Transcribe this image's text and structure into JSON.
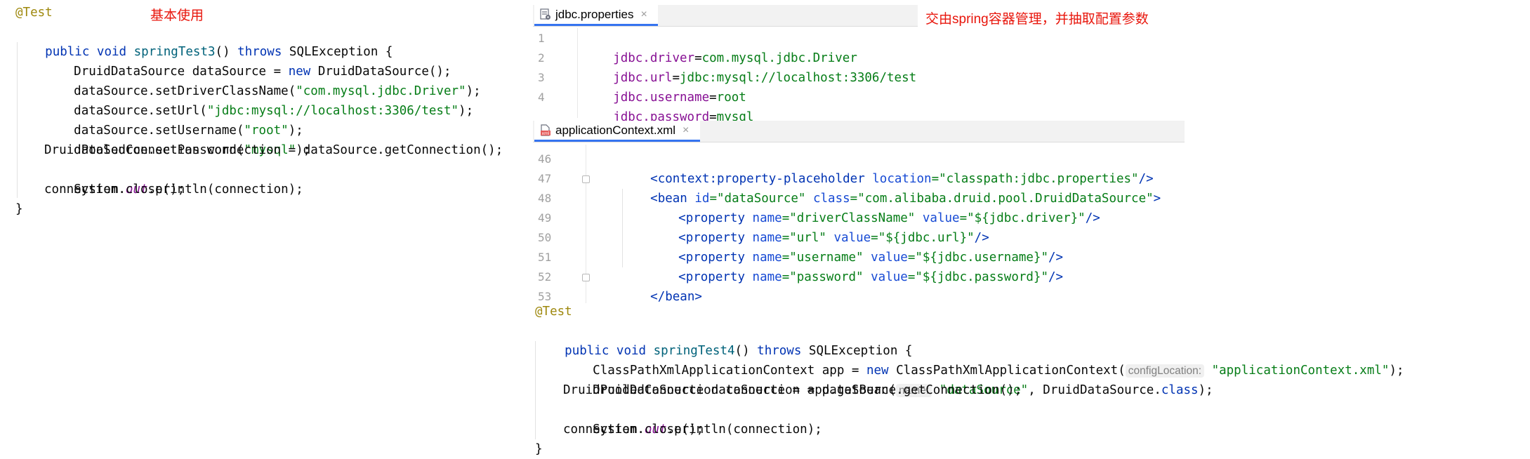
{
  "left_code": {
    "annotation": "@Test",
    "note": "基本使用",
    "signature": {
      "kw1": "public",
      "kw2": "void",
      "method": "springTest3",
      "parens": "()",
      "kw3": "throws",
      "rest": "SQLException {"
    },
    "line1": {
      "a": "DruidDataSource dataSource = ",
      "kw": "new",
      "b": " DruidDataSource();"
    },
    "line2": {
      "a": "dataSource.setDriverClassName(",
      "str": "\"com.mysql.jdbc.Driver\"",
      "b": ");"
    },
    "line3": {
      "a": "dataSource.setUrl(",
      "str": "\"jdbc:mysql://localhost:3306/test\"",
      "b": ");"
    },
    "line4": {
      "a": "dataSource.setUsername(",
      "str": "\"root\"",
      "b": ");"
    },
    "line5": {
      "a": "dataSource.setPassword(",
      "str": "\"mysql\"",
      "b": ");"
    },
    "line6": "DruidPooledConnection connection = dataSource.getConnection();",
    "line7": {
      "a": "System.",
      "static": "out",
      "b": ".println(connection);"
    },
    "line8": "connection.close();",
    "close": "}"
  },
  "props_editor": {
    "tab_label": "jdbc.properties",
    "close_glyph": "×",
    "note": "交由spring容器管理，并抽取配置参数",
    "lines": [
      {
        "num": "1",
        "key": "jdbc.driver",
        "eq": "=",
        "val": "com.mysql.jdbc.Driver"
      },
      {
        "num": "2",
        "key": "jdbc.url",
        "eq": "=",
        "val": "jdbc:mysql://localhost:3306/test"
      },
      {
        "num": "3",
        "key": "jdbc.username",
        "eq": "=",
        "val": "root"
      },
      {
        "num": "4",
        "key": "jdbc.password",
        "eq": "=",
        "val": "mysql"
      }
    ]
  },
  "xml_editor": {
    "tab_label": "applicationContext.xml",
    "close_glyph": "×",
    "line_numbers": [
      "46",
      "47",
      "48",
      "49",
      "50",
      "51",
      "52",
      "53"
    ],
    "l46": {
      "lt": "<",
      "ns": "context",
      "colon": ":",
      "tag": "property-placeholder",
      "attr": " location",
      "eq": "=",
      "val": "\"classpath:jdbc.properties\"",
      "end": "/>"
    },
    "l47": {
      "lt": "<",
      "tag": "bean",
      "attr1": " id",
      "eq1": "=",
      "val1": "\"dataSource\"",
      "attr2": " class",
      "eq2": "=",
      "val2": "\"com.alibaba.druid.pool.DruidDataSource\"",
      "end": ">"
    },
    "props": [
      {
        "lt": "<",
        "tag": "property",
        "a1": " name",
        "e1": "=",
        "v1": "\"driverClassName\"",
        "a2": " value",
        "e2": "=",
        "v2": "\"${jdbc.driver}\"",
        "end": "/>"
      },
      {
        "lt": "<",
        "tag": "property",
        "a1": " name",
        "e1": "=",
        "v1": "\"url\"",
        "a2": " value",
        "e2": "=",
        "v2": "\"${jdbc.url}\"",
        "end": "/>"
      },
      {
        "lt": "<",
        "tag": "property",
        "a1": " name",
        "e1": "=",
        "v1": "\"username\"",
        "a2": " value",
        "e2": "=",
        "v2": "\"${jdbc.username}\"",
        "end": "/>"
      },
      {
        "lt": "<",
        "tag": "property",
        "a1": " name",
        "e1": "=",
        "v1": "\"password\"",
        "a2": " value",
        "e2": "=",
        "v2": "\"${jdbc.password}\"",
        "end": "/>"
      }
    ],
    "l52": {
      "lt": "</",
      "tag": "bean",
      "end": ">"
    }
  },
  "right_code": {
    "annotation": "@Test",
    "signature": {
      "kw1": "public",
      "kw2": "void",
      "method": "springTest4",
      "parens": "()",
      "kw3": "throws",
      "rest": "SQLException {"
    },
    "line1": {
      "a": "ClassPathXmlApplicationContext app = ",
      "kw": "new",
      "b": " ClassPathXmlApplicationContext(",
      "hint": "configLocation:",
      "str": "\"applicationContext.xml\"",
      "c": ");"
    },
    "line2": {
      "a": "DruidDataSource dataSource = app.getBean(",
      "hint": "name:",
      "str": "\"dataSource\"",
      "b": ", DruidDataSource.",
      "kw": "class",
      "c": ");"
    },
    "line3": "DruidPooledConnection connection = dataSource.getConnection();",
    "line4": {
      "a": "System.",
      "static": "out",
      "b": ".println(connection);"
    },
    "line5": "connection.close();",
    "close": "}"
  }
}
